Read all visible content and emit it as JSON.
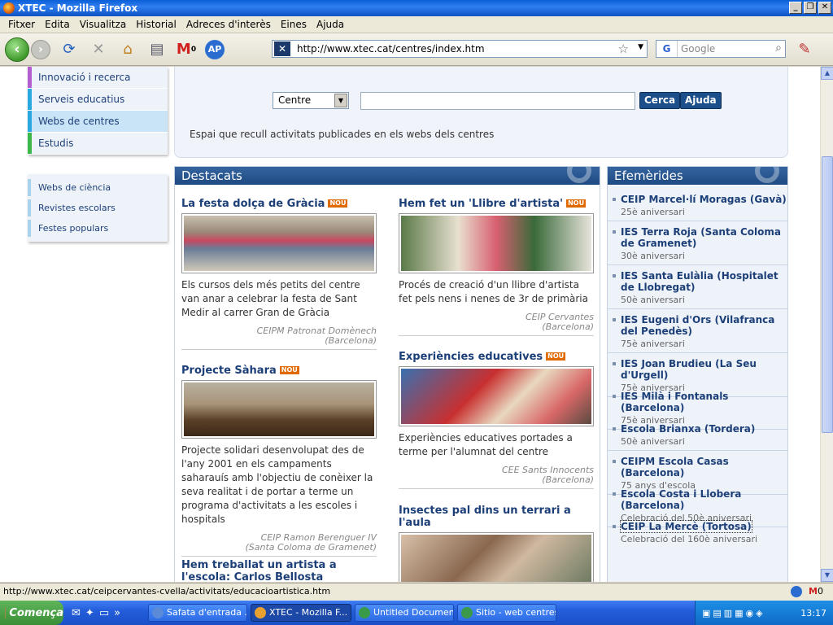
{
  "window": {
    "title": "XTEC - Mozilla Firefox"
  },
  "menubar": [
    "Fitxer",
    "Edita",
    "Visualitza",
    "Historial",
    "Adreces d'interès",
    "Eines",
    "Ajuda"
  ],
  "navbar": {
    "url": "http://www.xtec.cat/centres/index.htm",
    "search_placeholder": "Google",
    "gmail_count": "0"
  },
  "sidebar": {
    "primary": [
      {
        "label": "Innovació i recerca",
        "color": "#b35fd0"
      },
      {
        "label": "Serveis educatius",
        "color": "#2aa8e0"
      },
      {
        "label": "Webs de centres",
        "color": "#2aa8e0",
        "selected": true
      },
      {
        "label": "Estudis",
        "color": "#3cb84a"
      }
    ],
    "secondary": [
      "Webs de ciència",
      "Revistes escolars",
      "Festes populars"
    ]
  },
  "search": {
    "select_value": "Centre",
    "search_button": "Cerca",
    "help_button": "Ajuda",
    "description": "Espai que recull activitats publicades en els webs dels centres"
  },
  "destacats": {
    "title": "Destacats",
    "new_badge": "NOU",
    "articles": [
      {
        "title": "La festa dolça de Gràcia",
        "nou": true,
        "text": "Els cursos dels més petits del centre van anar a celebrar la festa de Sant Medir al carrer Gran de Gràcia",
        "source1": "CEIPM Patronat Domènech",
        "source2": "(Barcelona)"
      },
      {
        "title": "Hem fet un 'Llibre d'artista'",
        "nou": true,
        "text": "Procés de creació d'un llibre d'artista fet pels nens i nenes de 3r de primària",
        "source1": "CEIP Cervantes",
        "source2": "(Barcelona)"
      },
      {
        "title": "Projecte Sàhara",
        "nou": true,
        "text": "Projecte solidari desenvolupat des de l'any 2001 en els campaments saharauís amb l'objectiu de conèixer la seva realitat i de portar a terme un programa d'activitats a les escoles i hospitals",
        "source1": "CEIP Ramon Berenguer IV",
        "source2": "(Santa Coloma de Gramenet)"
      },
      {
        "title": "Experiències educatives",
        "nou": true,
        "text": "Experiències educatives portades a terme per l'alumnat del centre",
        "source1": "CEE Sants Innocents",
        "source2": "(Barcelona)"
      },
      {
        "title": "Hem treballat un artista a l'escola: Carlos Bellosta",
        "nou": false
      },
      {
        "title": "Insectes pal dins un terrari a l'aula",
        "nou": false
      }
    ]
  },
  "efemerides": {
    "title": "Efemèrides",
    "items": [
      {
        "name": "CEIP Marcel·lí Moragas (Gavà)",
        "ann": "25è aniversari"
      },
      {
        "name": "IES Terra Roja (Santa Coloma de Gramenet)",
        "ann": "30è aniversari"
      },
      {
        "name": "IES Santa Eulàlia (Hospitalet de Llobregat)",
        "ann": "50è aniversari"
      },
      {
        "name": "IES Eugeni d'Ors (Vilafranca del Penedès)",
        "ann": "75è aniversari"
      },
      {
        "name": "IES Joan Brudieu (La Seu d'Urgell)",
        "ann": "75è aniversari"
      },
      {
        "name": "IES Milà i Fontanals (Barcelona)",
        "ann": "75è aniversari"
      },
      {
        "name": "Escola Brianxa (Tordera)",
        "ann": "50è aniversari"
      },
      {
        "name": "CEIPM Escola Casas (Barcelona)",
        "ann": "75 anys d'escola"
      },
      {
        "name": "Escola Costa i Llobera (Barcelona)",
        "ann": "Celebració del 50è aniversari"
      },
      {
        "name": "CEIP La Mercè (Tortosa)",
        "ann": "Celebració del 160è aniversari"
      }
    ]
  },
  "statusbar": {
    "text": "http://www.xtec.cat/ceipcervantes-cvella/activitats/educacioartistica.htm",
    "gmail_count": "0"
  },
  "taskbar": {
    "start": "Comença",
    "tasks": [
      "Safata d'entrada ...",
      "XTEC - Mozilla F...",
      "Untitled Documen...",
      "Sitio - web centres"
    ],
    "clock": "13:17"
  }
}
